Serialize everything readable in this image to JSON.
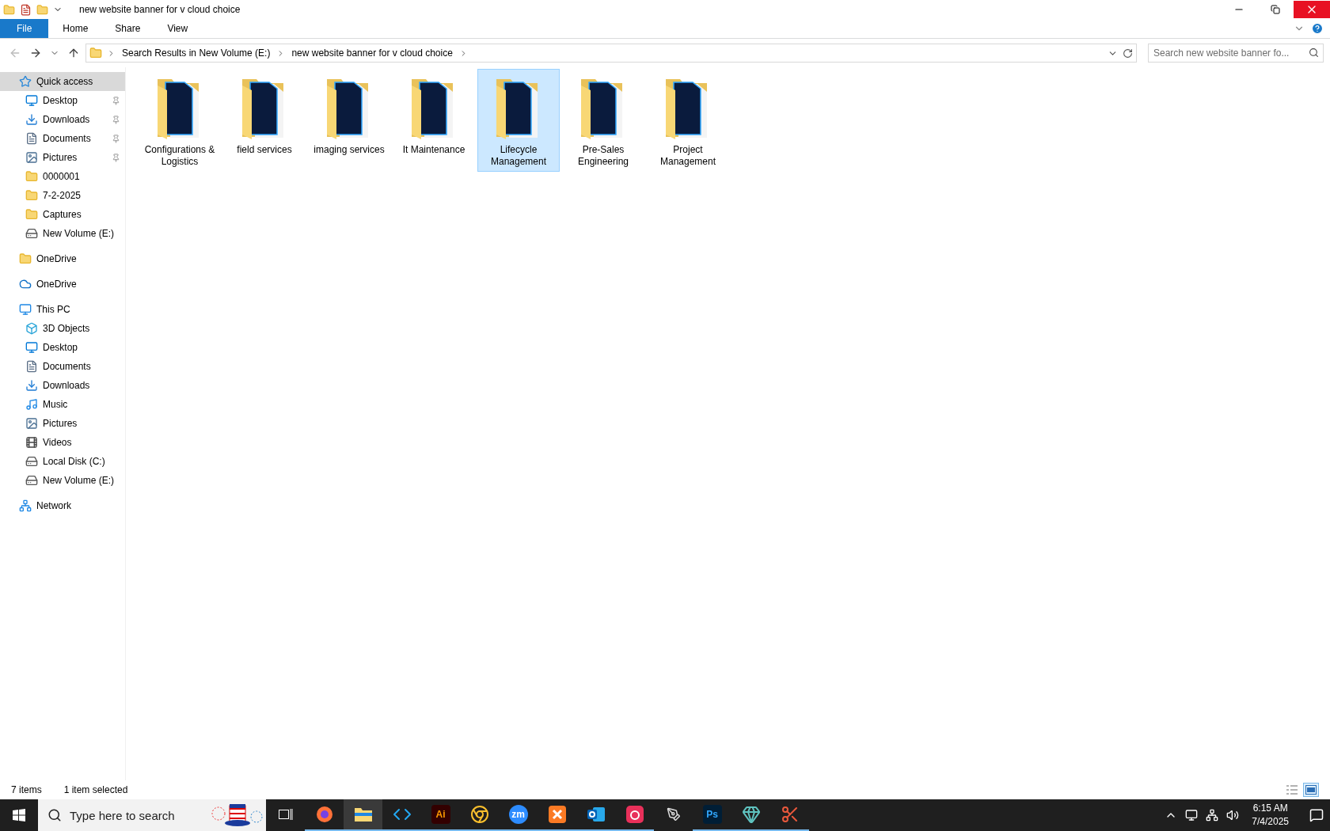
{
  "window": {
    "title": "new website banner for v cloud choice"
  },
  "ribbon_tabs": [
    {
      "label": "File",
      "selected": true
    },
    {
      "label": "Home",
      "selected": false
    },
    {
      "label": "Share",
      "selected": false
    },
    {
      "label": "View",
      "selected": false
    }
  ],
  "address_bar": {
    "crumbs": [
      "Search Results in New Volume (E:)",
      "new website banner for v cloud choice"
    ]
  },
  "search": {
    "placeholder": "Search new website banner fo..."
  },
  "sidebar": {
    "groups": [
      {
        "label": "Quick access",
        "kind": "star",
        "selected": true,
        "children": [
          {
            "label": "Desktop",
            "kind": "desktop",
            "pinned": true
          },
          {
            "label": "Downloads",
            "kind": "download",
            "pinned": true
          },
          {
            "label": "Documents",
            "kind": "document",
            "pinned": true
          },
          {
            "label": "Pictures",
            "kind": "pictures",
            "pinned": true
          },
          {
            "label": "0000001",
            "kind": "folder",
            "pinned": false
          },
          {
            "label": "7-2-2025",
            "kind": "folder",
            "pinned": false
          },
          {
            "label": "Captures",
            "kind": "folder",
            "pinned": false
          },
          {
            "label": "New Volume (E:)",
            "kind": "drive",
            "pinned": false
          }
        ]
      },
      {
        "label": "OneDrive",
        "kind": "folder",
        "selected": false
      },
      {
        "label": "OneDrive",
        "kind": "cloud",
        "selected": false
      },
      {
        "label": "This PC",
        "kind": "pc",
        "selected": false,
        "children": [
          {
            "label": "3D Objects",
            "kind": "cube",
            "pinned": false
          },
          {
            "label": "Desktop",
            "kind": "desktop",
            "pinned": false
          },
          {
            "label": "Documents",
            "kind": "document",
            "pinned": false
          },
          {
            "label": "Downloads",
            "kind": "download",
            "pinned": false
          },
          {
            "label": "Music",
            "kind": "music",
            "pinned": false
          },
          {
            "label": "Pictures",
            "kind": "pictures",
            "pinned": false
          },
          {
            "label": "Videos",
            "kind": "video",
            "pinned": false
          },
          {
            "label": "Local Disk (C:)",
            "kind": "drive",
            "pinned": false
          },
          {
            "label": "New Volume (E:)",
            "kind": "drive",
            "pinned": false
          }
        ]
      },
      {
        "label": "Network",
        "kind": "network",
        "selected": false
      }
    ]
  },
  "folders": [
    {
      "name": "Configurations & Logistics",
      "selected": false
    },
    {
      "name": "field services",
      "selected": false
    },
    {
      "name": "imaging services",
      "selected": false
    },
    {
      "name": "It Maintenance",
      "selected": false
    },
    {
      "name": "Lifecycle Management",
      "selected": true
    },
    {
      "name": "Pre-Sales Engineering",
      "selected": false
    },
    {
      "name": "Project Management",
      "selected": false
    }
  ],
  "status_bar": {
    "item_count": "7 items",
    "selection": "1 item selected"
  },
  "taskbar": {
    "search_placeholder": "Type here to search",
    "apps": [
      {
        "kind": "firefox",
        "running": true,
        "selected": false
      },
      {
        "kind": "explorer",
        "running": true,
        "selected": true
      },
      {
        "kind": "vscode",
        "running": true,
        "selected": false
      },
      {
        "kind": "illustrator",
        "label": "Ai",
        "running": true,
        "selected": false
      },
      {
        "kind": "chrome",
        "running": true,
        "selected": false
      },
      {
        "kind": "zoom",
        "label": "zm",
        "running": true,
        "selected": false
      },
      {
        "kind": "xampp",
        "running": true,
        "selected": false
      },
      {
        "kind": "outlook",
        "running": true,
        "selected": false
      },
      {
        "kind": "cloud",
        "running": true,
        "selected": false
      },
      {
        "kind": "pen",
        "running": false,
        "selected": false
      },
      {
        "kind": "photoshop",
        "label": "Ps",
        "running": true,
        "selected": false
      },
      {
        "kind": "gem",
        "running": true,
        "selected": false
      },
      {
        "kind": "scissors",
        "running": true,
        "selected": false
      }
    ],
    "time": "6:15 AM",
    "date": "7/4/2025"
  }
}
